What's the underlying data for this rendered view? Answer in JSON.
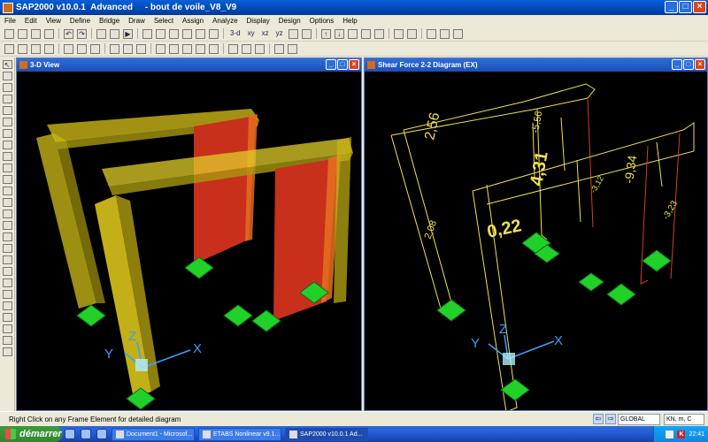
{
  "app": {
    "title": "SAP2000 v10.0.1  Advanced     - bout de voile_V8_V9"
  },
  "menu": [
    "File",
    "Edit",
    "View",
    "Define",
    "Bridge",
    "Draw",
    "Select",
    "Assign",
    "Analyze",
    "Display",
    "Design",
    "Options",
    "Help"
  ],
  "toolbar": {
    "view_labels": [
      "3-d",
      "xy",
      "xz",
      "yz"
    ]
  },
  "left_pane": {
    "title": "3-D View",
    "axis_labels": {
      "x": "X",
      "y": "Y",
      "z": "Z"
    }
  },
  "right_pane": {
    "title": "Shear Force 2-2 Diagram   (EX)",
    "values": [
      "2,56",
      "-5,56",
      "4,31",
      "0,22",
      "2,08",
      "-9,34",
      "-3,12",
      "-3,23"
    ],
    "axis_labels": {
      "x": "X",
      "y": "Y",
      "z": "Z"
    }
  },
  "statusbar": {
    "message": "Right Click on any Frame Element for detailed diagram",
    "coord_system": "GLOBAL",
    "units": "KN, m, C"
  },
  "taskbar": {
    "start_label": "démarrer",
    "tasks": [
      "Document1 - Microsof...",
      "ETABS Nonlinear v9.1...",
      "SAP2000 v10.0.1  Ad..."
    ],
    "clock": "22:41"
  },
  "colors": {
    "column_yellow": "#d8c21a",
    "wall_red": "#c8301c",
    "support_green": "#22d02a",
    "diagram_line": "#f0e050",
    "axis_cyan": "#3aa0ff"
  }
}
